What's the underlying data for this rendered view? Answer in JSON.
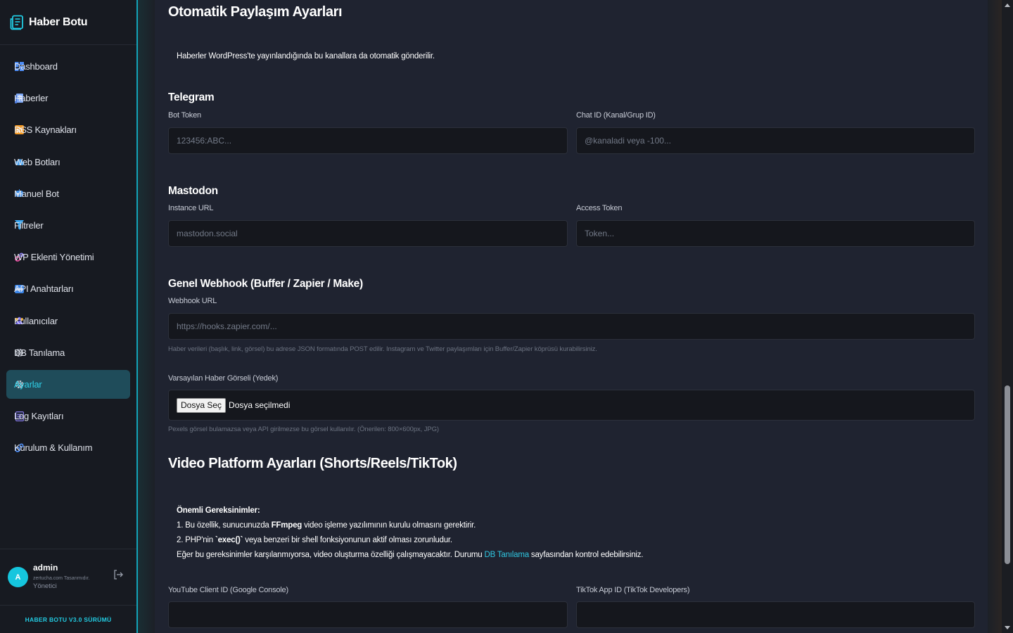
{
  "brand": {
    "title": "Haber Botu"
  },
  "sidebar": {
    "items": [
      {
        "label": "Dashboard",
        "icon": "dashboard-icon",
        "active": false
      },
      {
        "label": "Haberler",
        "icon": "newspaper-icon",
        "active": false
      },
      {
        "label": "RSS Kaynakları",
        "icon": "rss-icon",
        "active": false
      },
      {
        "label": "Web Botları",
        "icon": "cloud-icon",
        "active": false
      },
      {
        "label": "Manuel Bot",
        "icon": "robot-icon",
        "active": false
      },
      {
        "label": "Filtreler",
        "icon": "filter-icon",
        "active": false
      },
      {
        "label": "WP Eklenti Yönetimi",
        "icon": "gears-icon",
        "active": false
      },
      {
        "label": "API Anahtarları",
        "icon": "api-icon",
        "active": false
      },
      {
        "label": "Kullanıcılar",
        "icon": "users-icon",
        "active": false
      },
      {
        "label": "DB Tanılama",
        "icon": "gear-icon",
        "active": false
      },
      {
        "label": "Ayarlar",
        "icon": "settings-icon",
        "active": true
      },
      {
        "label": "Log Kayıtları",
        "icon": "log-icon",
        "active": false
      },
      {
        "label": "Kurulum & Kullanım",
        "icon": "gears-icon",
        "active": false
      }
    ]
  },
  "user": {
    "initial": "A",
    "name": "admin",
    "sub": "zertucha.com Tasarımıdır.",
    "role": "Yönetici"
  },
  "version": "HABER BOTU V3.0 SÜRÜMÜ",
  "main": {
    "title": "Otomatik Paylaşım Ayarları",
    "description": "Haberler WordPress'te yayınlandığında bu kanallara da otomatik gönderilir.",
    "telegram": {
      "title": "Telegram",
      "bot_token_label": "Bot Token",
      "bot_token_placeholder": "123456:ABC...",
      "chat_id_label": "Chat ID (Kanal/Grup ID)",
      "chat_id_placeholder": "@kanaladi veya -100..."
    },
    "mastodon": {
      "title": "Mastodon",
      "instance_label": "Instance URL",
      "instance_placeholder": "mastodon.social",
      "token_label": "Access Token",
      "token_placeholder": "Token..."
    },
    "webhook": {
      "title": "Genel Webhook (Buffer / Zapier / Make)",
      "url_label": "Webhook URL",
      "url_placeholder": "https://hooks.zapier.com/...",
      "help": "Haber verileri (başlık, link, görsel) bu adrese JSON formatında POST edilir. Instagram ve Twitter paylaşımları için Buffer/Zapier köprüsü kurabilirsiniz."
    },
    "default_image": {
      "label": "Varsayılan Haber Görseli (Yedek)",
      "button": "Dosya Seç",
      "status": "Dosya seçilmedi",
      "help": "Pexels görsel bulamazsa veya API girilmezse bu görsel kullanılır. (Önerilen: 800×600px, JPG)"
    },
    "video": {
      "title": "Video Platform Ayarları (Shorts/Reels/TikTok)",
      "req_title": "Önemli Gereksinimler:",
      "req1_pre": "1. Bu özellik, sunucunuzda ",
      "req1_bold": "FFmpeg",
      "req1_post": " video işleme yazılımının kurulu olmasını gerektirir.",
      "req2_pre": "2. PHP'nin ",
      "req2_bold": "`exec()`",
      "req2_post": " veya benzeri bir shell fonksiyonunun aktif olması zorunludur.",
      "req3_pre": "Eğer bu gereksinimler karşılanmıyorsa, video oluşturma özelliği çalışmayacaktır. Durumu ",
      "req3_link": "DB Tanılama",
      "req3_post": " sayfasından kontrol edebilirsiniz.",
      "youtube_label": "YouTube Client ID (Google Console)",
      "tiktok_label": "TikTok App ID (TikTok Developers)"
    }
  },
  "colors": {
    "accent": "#13a3b8",
    "active_bg": "#1f4c5a",
    "link": "#2fc6e0"
  }
}
